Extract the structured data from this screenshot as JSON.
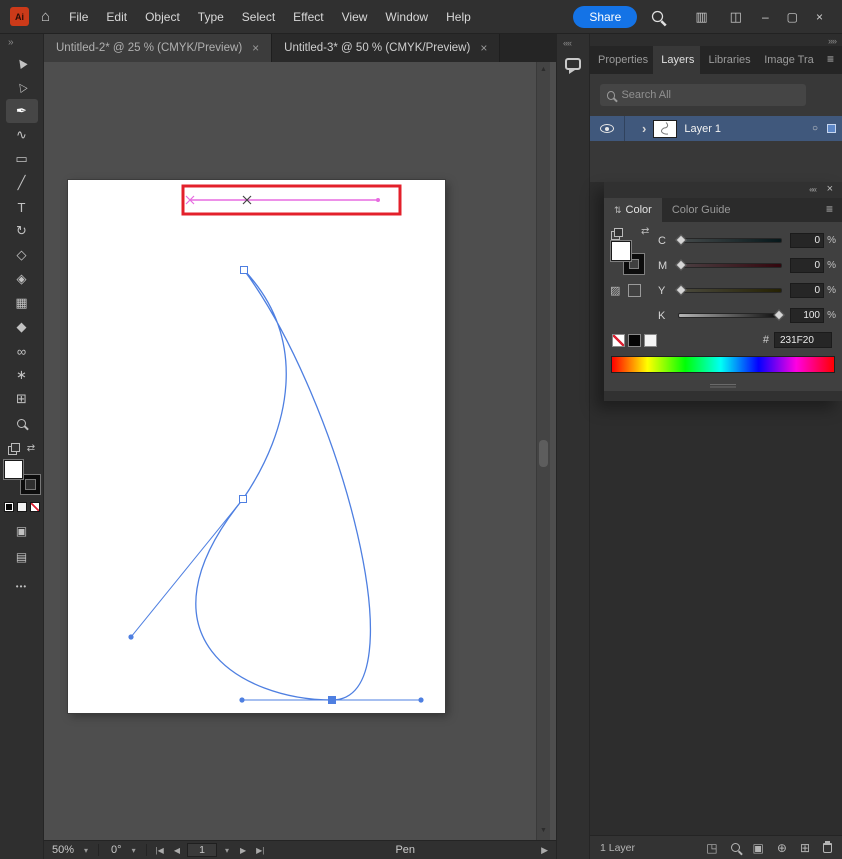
{
  "menubar": {
    "app_label": "Ai",
    "home_icon": "⌂",
    "menus": [
      "File",
      "Edit",
      "Object",
      "Type",
      "Select",
      "Effect",
      "View",
      "Window",
      "Help"
    ],
    "share_label": "Share"
  },
  "window": {
    "workspace_icon": "▥",
    "panel_icon": "◫",
    "minimize_icon": "–",
    "maximize_icon": "▢",
    "close_icon": "×"
  },
  "doc_tabs": {
    "tab1": {
      "label": "Untitled-2* @ 25 % (CMYK/Preview)",
      "close_icon": "×"
    },
    "tab2": {
      "label": "Untitled-3* @ 50 % (CMYK/Preview)",
      "close_icon": "×"
    }
  },
  "toolbar": {
    "collapse_icon": "»",
    "tools": [
      {
        "name": "selection",
        "glyph": "▶"
      },
      {
        "name": "direct-selection",
        "glyph": "▷"
      },
      {
        "name": "pen",
        "glyph": "✒"
      },
      {
        "name": "curvature",
        "glyph": "∿"
      },
      {
        "name": "rectangle",
        "glyph": "▭"
      },
      {
        "name": "paintbrush",
        "glyph": "╱"
      },
      {
        "name": "type",
        "glyph": "T"
      },
      {
        "name": "rotate",
        "glyph": "↻"
      },
      {
        "name": "eraser",
        "glyph": "◇"
      },
      {
        "name": "shape-builder",
        "glyph": "◈"
      },
      {
        "name": "mesh",
        "glyph": "▦"
      },
      {
        "name": "eyedropper",
        "glyph": "◆"
      },
      {
        "name": "blend",
        "glyph": "∞"
      },
      {
        "name": "symbol-sprayer",
        "glyph": "∗"
      },
      {
        "name": "artboard",
        "glyph": "⊞"
      },
      {
        "name": "zoom",
        "glyph": ""
      }
    ],
    "swap_icon": "⇄",
    "draw_mode_icon": "▣",
    "screen_mode_icon": "▤",
    "overflow_icon": "•••"
  },
  "canvas": {
    "scroll_up_icon": "▲",
    "scroll_down_icon": "▼"
  },
  "comment_bar": {
    "collapse_icon": "««"
  },
  "panels": {
    "expand_icon": "»»",
    "tabs": [
      "Properties",
      "Layers",
      "Libraries",
      "Image Tra"
    ],
    "menu_icon": "≡",
    "layers": {
      "search_placeholder": "Search All",
      "row": {
        "name": "Layer 1",
        "expand_icon": "›",
        "target_icon": "○"
      },
      "footer": {
        "count": "1 Layer",
        "export_icon": "◳",
        "mask_icon": "▣",
        "sublayer_icon": "⊕",
        "newlayer_icon": "⊞"
      }
    },
    "color": {
      "collapse_icon": "««",
      "close_icon": "×",
      "tab_arrows_icon": "⇅",
      "tabs": [
        "Color",
        "Color Guide"
      ],
      "menu_icon": "≡",
      "swap_icon": "⇄",
      "pattern_icon": "▨",
      "sliders": [
        {
          "channel": "C",
          "value": "0",
          "unit": "%"
        },
        {
          "channel": "M",
          "value": "0",
          "unit": "%"
        },
        {
          "channel": "Y",
          "value": "0",
          "unit": "%"
        },
        {
          "channel": "K",
          "value": "100",
          "unit": "%"
        }
      ],
      "hex_label": "#",
      "hex_value": "231F20"
    }
  },
  "statusbar": {
    "zoom": "50%",
    "rotation": "0°",
    "artboard_number": "1",
    "tool_name": "Pen",
    "dropdown_icon": "▾",
    "first_icon": "|◀",
    "prev_icon": "◀",
    "next_icon": "▶",
    "last_icon": "▶|",
    "forward_icon": "▶"
  },
  "colors": {
    "accent_blue": "#1473e6",
    "path_blue": "#4e7fe1",
    "selection_row_blue": "#40587c",
    "preview_magenta": "#e76be0",
    "annotation_red": "#e3202b",
    "pasteboard_gray": "#4e4e4e",
    "hex_swatch": "#231F20"
  }
}
